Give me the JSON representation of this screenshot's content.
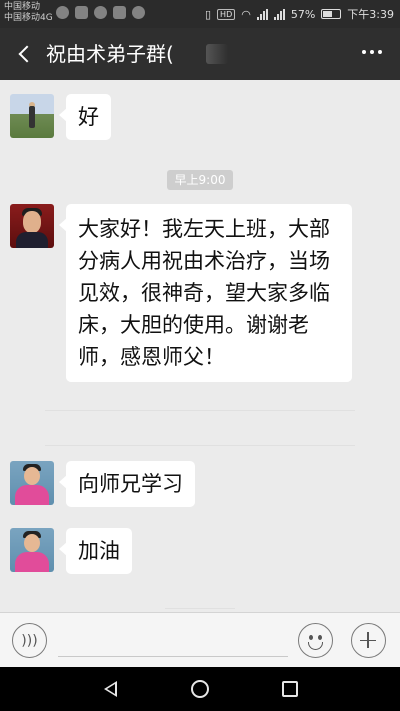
{
  "status_bar": {
    "carrier_line1": "中国移动",
    "carrier_line2": "中国移动4G",
    "hd": "HD",
    "battery_percent_text": "57%",
    "battery_level": 0.57,
    "time": "下午3:39"
  },
  "header": {
    "title": "祝由术弟子群(",
    "back_icon": "chevron-left-icon",
    "more_icon": "more-dots-icon"
  },
  "messages": [
    {
      "id": "m1",
      "text": "好",
      "avatar": "outdoor-photo"
    },
    {
      "id": "m2",
      "text": "大家好！我左天上班，大部分病人用祝由术治疗，当场见效，很神奇，望大家多临床，大胆的使用。谢谢老师，感恩师父！",
      "avatar": "suit-photo"
    },
    {
      "id": "m3",
      "text": "向师兄学习",
      "avatar": "kid-photo"
    },
    {
      "id": "m4",
      "text": "加油",
      "avatar": "kid-photo"
    }
  ],
  "timestamp": "早上9:00",
  "input_bar": {
    "voice_icon": "voice-icon",
    "emoji_icon": "emoji-icon",
    "plus_icon": "plus-icon"
  },
  "nav_bar": {
    "back_icon": "nav-back-icon",
    "home_icon": "nav-home-icon",
    "recent_icon": "nav-recent-icon"
  },
  "colors": {
    "chat_bg": "#ebebeb",
    "header_bg": "#2f2f2f",
    "bubble_bg": "#ffffff"
  }
}
